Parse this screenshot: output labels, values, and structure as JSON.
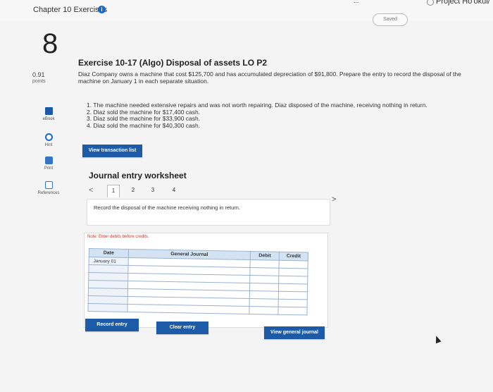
{
  "header": {
    "chapter_title": "Chapter 10 Exercises",
    "info_icon": "i",
    "top_right_truncated": "...",
    "project_title": "Project Ho'okui/",
    "saved_label": "Saved"
  },
  "question": {
    "number": "8",
    "points_value": "0.91",
    "points_label": "points"
  },
  "side_tools": [
    {
      "label": "eBook",
      "icon": "book-icon"
    },
    {
      "label": "Hint",
      "icon": "lifebuoy-icon"
    },
    {
      "label": "Print",
      "icon": "printer-icon"
    },
    {
      "label": "References",
      "icon": "references-icon"
    }
  ],
  "exercise": {
    "title": "Exercise 10-17 (Algo) Disposal of assets LO P2",
    "description": "Diaz Company owns a machine that cost $125,700 and has accumulated depreciation of $91,800. Prepare the entry to record the disposal of the machine on January 1 in each separate situation.",
    "situations": [
      "1. The machine needed extensive repairs and was not worth repairing. Diaz disposed of the machine, receiving nothing in return.",
      "2. Diaz sold the machine for $17,400 cash.",
      "3. Diaz sold the machine for $33,900 cash.",
      "4. Diaz sold the machine for $40,300 cash."
    ]
  },
  "buttons": {
    "view_transaction_list": "View transaction list",
    "record_entry": "Record entry",
    "clear_entry": "Clear entry",
    "view_general_journal": "View general journal"
  },
  "worksheet": {
    "title": "Journal entry worksheet",
    "prev_arrow": "<",
    "next_arrow": ">",
    "tabs": [
      "1",
      "2",
      "3",
      "4"
    ],
    "active_tab": "1",
    "instruction": "Record the disposal of the machine receiving nothing in return.",
    "note": "Note: Enter debits before credits.",
    "table": {
      "headers": [
        "Date",
        "General Journal",
        "Debit",
        "Credit"
      ],
      "rows": [
        [
          "January 01",
          "",
          "",
          ""
        ],
        [
          "",
          "",
          "",
          ""
        ],
        [
          "",
          "",
          "",
          ""
        ],
        [
          "",
          "",
          "",
          ""
        ],
        [
          "",
          "",
          "",
          ""
        ],
        [
          "",
          "",
          "",
          ""
        ],
        [
          "",
          "",
          "",
          ""
        ]
      ]
    }
  },
  "colors": {
    "primary_button": "#1d5ba8",
    "table_header": "#d4e3f4",
    "note_red": "#c0392b"
  }
}
